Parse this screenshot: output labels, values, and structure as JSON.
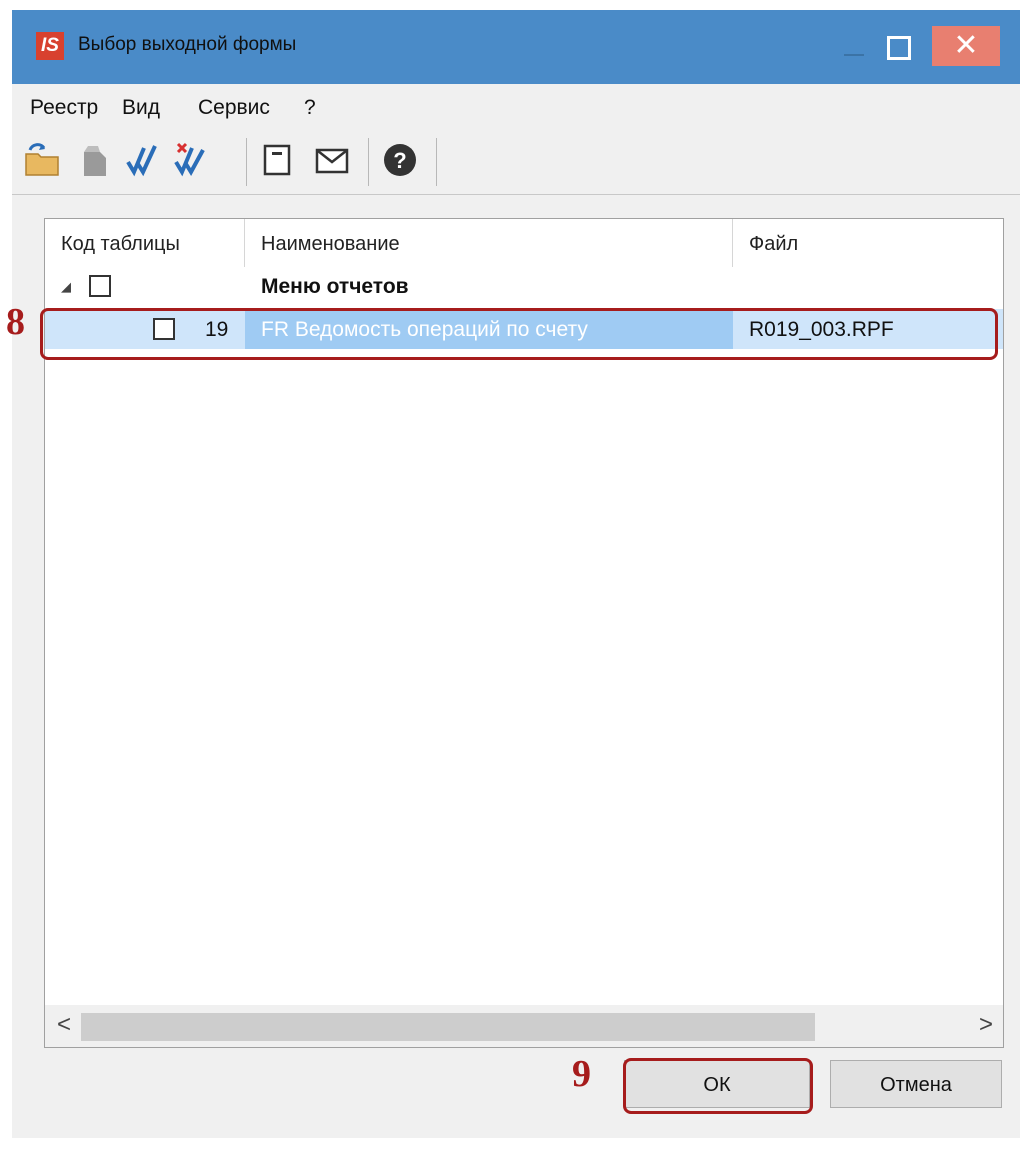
{
  "window": {
    "title": "Выбор выходной формы",
    "app_icon_text": "IS",
    "close_glyph": "✕"
  },
  "menu": {
    "items": [
      "Реестр",
      "Вид",
      "Сервис",
      "?"
    ]
  },
  "toolbar": {
    "icons": [
      "open-folder-icon",
      "open-item-icon",
      "check-all-icon",
      "uncheck-all-icon",
      "document-icon",
      "envelope-icon",
      "help-icon"
    ]
  },
  "grid": {
    "columns": [
      "Код таблицы",
      "Наименование",
      "Файл"
    ],
    "group_row": {
      "name": "Меню отчетов",
      "expander": "◢"
    },
    "rows": [
      {
        "code": "19",
        "name": "FR Ведомость операций по счету",
        "file": "R019_003.RPF"
      }
    ],
    "scroll_left": "<",
    "scroll_right": ">"
  },
  "buttons": {
    "ok": "ОК",
    "cancel": "Отмена"
  },
  "annotations": {
    "step_row": "8",
    "step_ok": "9"
  },
  "colors": {
    "titlebar": "#4a8bc8",
    "selection": "#cfe5fa",
    "selection_text": "#4a9ae0",
    "annotation": "#a61c1c",
    "close_button": "#e87f70"
  }
}
